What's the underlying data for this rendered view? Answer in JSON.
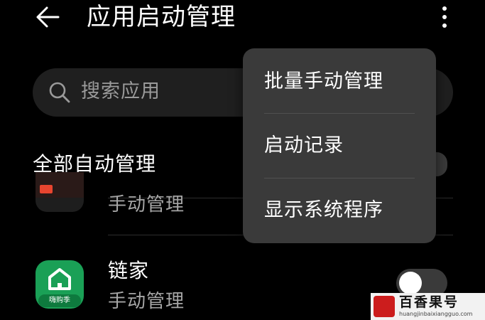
{
  "header": {
    "title": "应用启动管理",
    "back_icon": "arrow-left-icon",
    "more_icon": "more-vertical-icon"
  },
  "search": {
    "placeholder": "搜索应用",
    "icon": "search-icon"
  },
  "all_manage": {
    "label": "全部自动管理"
  },
  "app_list": [
    {
      "name": "",
      "status": "手动管理"
    },
    {
      "name": "链家",
      "status": "手动管理",
      "icon_tag": "嗨购季",
      "toggle_on": false
    }
  ],
  "menu": {
    "items": [
      "批量手动管理",
      "启动记录",
      "显示系统程序"
    ]
  },
  "watermark": {
    "text": "百香果号",
    "url": "huangjinbaixiangguo.com"
  },
  "colors": {
    "background": "#000000",
    "surface": "#1f1f1f",
    "menu": "#3a3a3a",
    "secondary_text": "#a6a6a6",
    "lianjia_green": "#1aa056"
  }
}
